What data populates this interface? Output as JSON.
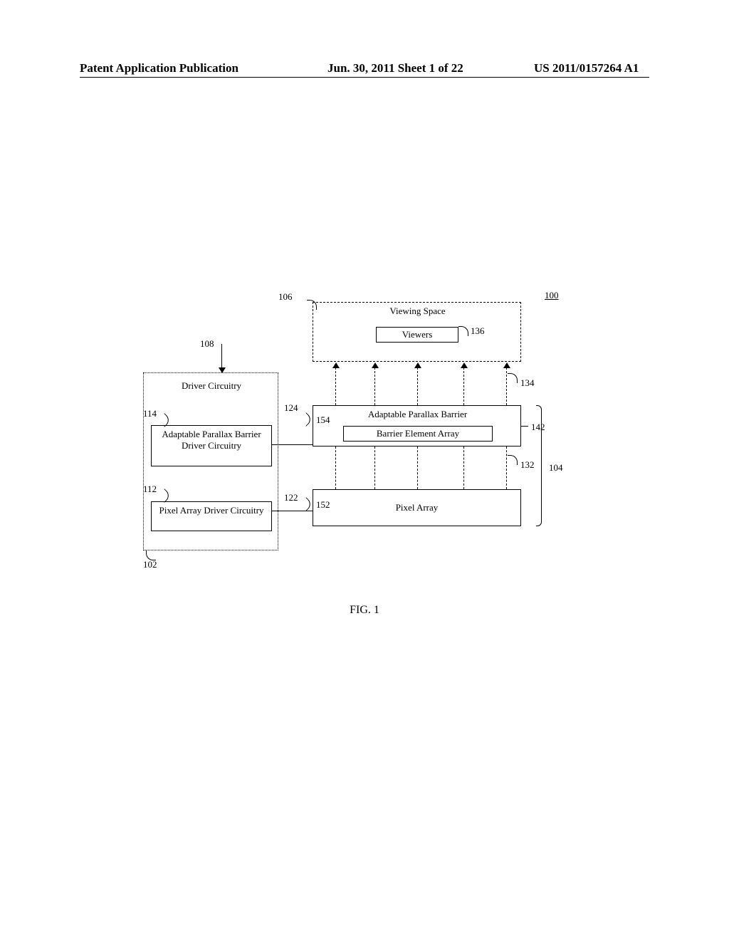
{
  "header": {
    "left": "Patent Application Publication",
    "center": "Jun. 30, 2011  Sheet 1 of 22",
    "right": "US 2011/0157264 A1"
  },
  "refs": {
    "r100": "100",
    "r102": "102",
    "r104": "104",
    "r106": "106",
    "r108": "108",
    "r112": "112",
    "r114": "114",
    "r122": "122",
    "r124": "124",
    "r132": "132",
    "r134": "134",
    "r136": "136",
    "r142": "142",
    "r152": "152",
    "r154": "154"
  },
  "blocks": {
    "driver_title": "Driver Circuitry",
    "apb_driver": "Adaptable Parallax Barrier Driver Circuitry",
    "pa_driver": "Pixel Array Driver Circuitry",
    "viewing_space": "Viewing Space",
    "viewers": "Viewers",
    "apb_title": "Adaptable Parallax Barrier",
    "bea": "Barrier Element Array",
    "pixel_array": "Pixel Array"
  },
  "figure_caption": "FIG. 1"
}
